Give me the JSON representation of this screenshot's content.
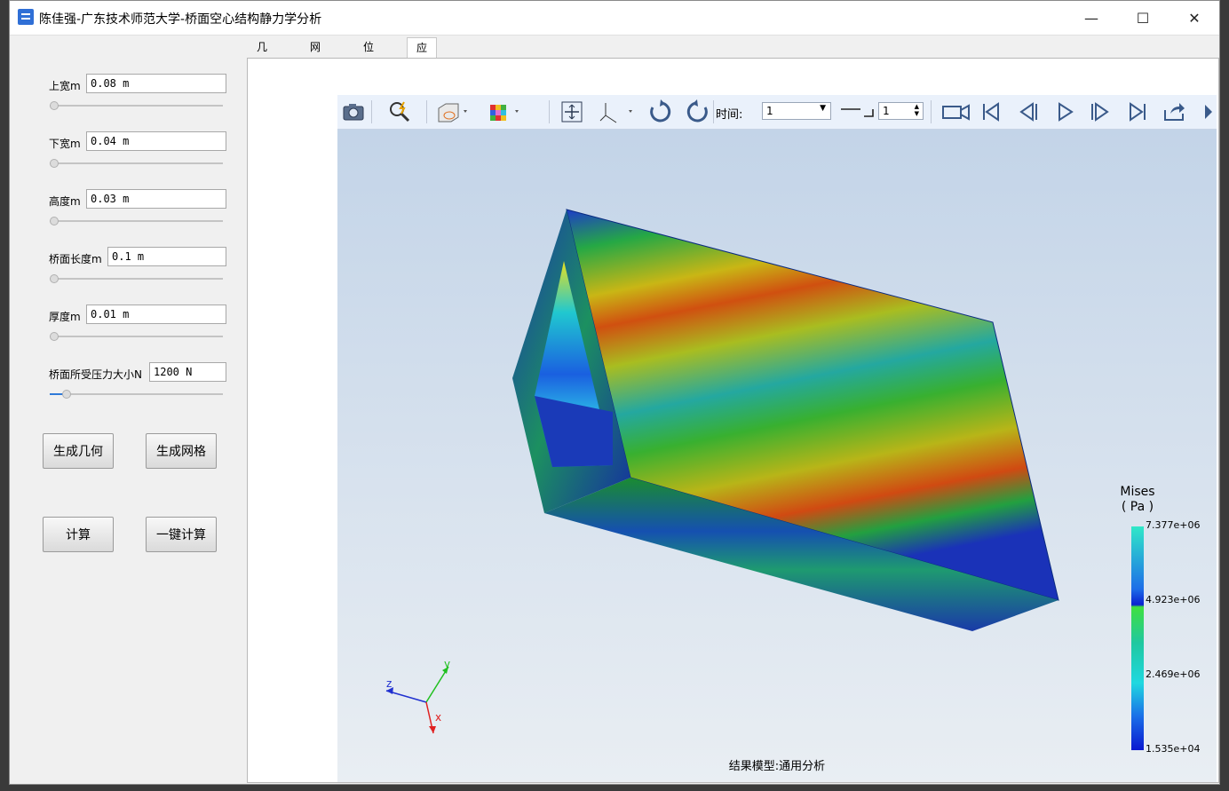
{
  "window": {
    "title": "陈佳强-广东技术师范大学-桥面空心结构静力学分析",
    "minimize": "—",
    "maximize": "☐",
    "close": "✕"
  },
  "params": [
    {
      "label": "上宽m",
      "value": "0.08 m",
      "slider": 0.0
    },
    {
      "label": "下宽m",
      "value": "0.04 m",
      "slider": 0.0
    },
    {
      "label": "高度m",
      "value": "0.03 m",
      "slider": 0.0
    },
    {
      "label": "桥面长度m",
      "value": "0.1 m",
      "slider": 0.0
    },
    {
      "label": "厚度m",
      "value": "0.01 m",
      "slider": 0.0
    },
    {
      "label": "桥面所受压力大小N",
      "value": "1200 N",
      "slider": 0.1
    }
  ],
  "buttons": {
    "gen_geometry": "生成几何",
    "gen_mesh": "生成网格",
    "compute": "计算",
    "one_click": "一键计算"
  },
  "tabs": [
    "几何图",
    "网格图",
    "位移图",
    "应力图"
  ],
  "active_tab": "应力图",
  "toolbar": {
    "time_label": "时间:",
    "time_value": "1",
    "step_value": "1"
  },
  "legend": {
    "title": "Mises",
    "unit": "( Pa )",
    "ticks": [
      "7.377e+06",
      "4.923e+06",
      "2.469e+06",
      "1.535e+04"
    ]
  },
  "axes": {
    "x": "x",
    "y": "y",
    "z": "z"
  },
  "result_label": "结果模型:通用分析",
  "colors": {
    "accent": "#2f7ad8",
    "viewport_top": "#c3d4e8",
    "viewport_bottom": "#e9eef3"
  }
}
